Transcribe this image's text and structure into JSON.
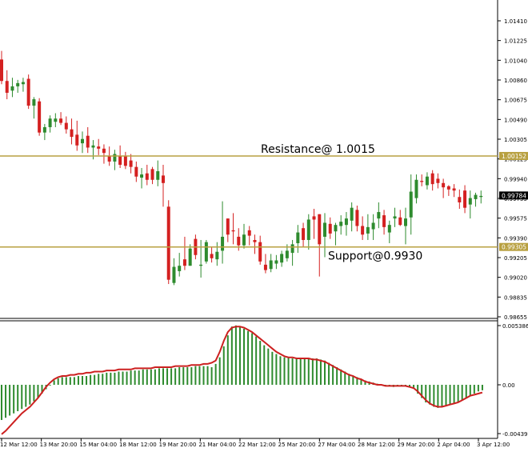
{
  "chart_data": [
    {
      "type": "candlestick",
      "title": "",
      "up_color": "#2e8b2e",
      "down_color": "#d42020",
      "ylim": [
        0.9866,
        1.015
      ],
      "y_ticks": [
        "1.01410",
        "1.01225",
        "1.01040",
        "1.00860",
        "1.00675",
        "1.00490",
        "1.00305",
        "1.00125",
        "0.99940",
        "0.99755",
        "0.99575",
        "0.99390",
        "0.99205",
        "0.99020",
        "0.98835",
        "0.98655"
      ],
      "current_price": "0.99784",
      "candles": [
        {
          "o": 1.0105,
          "h": 1.0113,
          "l": 1.0082,
          "c": 1.0085
        },
        {
          "o": 1.0085,
          "h": 1.0095,
          "l": 1.0068,
          "c": 1.0074
        },
        {
          "o": 1.0076,
          "h": 1.0088,
          "l": 1.007,
          "c": 1.008
        },
        {
          "o": 1.008,
          "h": 1.0086,
          "l": 1.0074,
          "c": 1.0083
        },
        {
          "o": 1.0082,
          "h": 1.0088,
          "l": 1.0075,
          "c": 1.0084
        },
        {
          "o": 1.0087,
          "h": 1.0091,
          "l": 1.0059,
          "c": 1.0062
        },
        {
          "o": 1.0062,
          "h": 1.007,
          "l": 1.005,
          "c": 1.0068
        },
        {
          "o": 1.0066,
          "h": 1.0069,
          "l": 1.0034,
          "c": 1.0037
        },
        {
          "o": 1.0037,
          "h": 1.0045,
          "l": 1.003,
          "c": 1.0042
        },
        {
          "o": 1.0042,
          "h": 1.0053,
          "l": 1.0037,
          "c": 1.005
        },
        {
          "o": 1.0047,
          "h": 1.0055,
          "l": 1.0042,
          "c": 1.005
        },
        {
          "o": 1.005,
          "h": 1.0056,
          "l": 1.0044,
          "c": 1.0046
        },
        {
          "o": 1.0046,
          "h": 1.0052,
          "l": 1.0036,
          "c": 1.004
        },
        {
          "o": 1.004,
          "h": 1.005,
          "l": 1.0026,
          "c": 1.0033
        },
        {
          "o": 1.0035,
          "h": 1.0048,
          "l": 1.002,
          "c": 1.0025
        },
        {
          "o": 1.0027,
          "h": 1.0038,
          "l": 1.0018,
          "c": 1.0031
        },
        {
          "o": 1.0034,
          "h": 1.0042,
          "l": 1.0018,
          "c": 1.0023
        },
        {
          "o": 1.0023,
          "h": 1.003,
          "l": 1.0012,
          "c": 1.0025
        },
        {
          "o": 1.0024,
          "h": 1.0031,
          "l": 1.0016,
          "c": 1.0022
        },
        {
          "o": 1.0022,
          "h": 1.0026,
          "l": 1.0008,
          "c": 1.0018
        },
        {
          "o": 1.0015,
          "h": 1.0024,
          "l": 1.0006,
          "c": 1.001
        },
        {
          "o": 1.001,
          "h": 1.0021,
          "l": 1.0002,
          "c": 1.0017
        },
        {
          "o": 1.0015,
          "h": 1.0025,
          "l": 1.0004,
          "c": 1.0007
        },
        {
          "o": 1.0015,
          "h": 1.0019,
          "l": 1.0003,
          "c": 1.0006
        },
        {
          "o": 1.0011,
          "h": 1.0017,
          "l": 0.9999,
          "c": 1.0005
        },
        {
          "o": 1.0005,
          "h": 1.001,
          "l": 0.9991,
          "c": 0.9996
        },
        {
          "o": 0.9995,
          "h": 1.0004,
          "l": 0.9985,
          "c": 0.9998
        },
        {
          "o": 0.9999,
          "h": 1.0007,
          "l": 0.9988,
          "c": 0.9993
        },
        {
          "o": 1.0003,
          "h": 1.0005,
          "l": 0.9989,
          "c": 0.9993
        },
        {
          "o": 0.9993,
          "h": 1.0011,
          "l": 0.9987,
          "c": 1.0001
        },
        {
          "o": 0.9997,
          "h": 1.0007,
          "l": 0.9968,
          "c": 0.999
        },
        {
          "o": 0.9968,
          "h": 0.9974,
          "l": 0.9896,
          "c": 0.99
        },
        {
          "o": 0.9897,
          "h": 0.992,
          "l": 0.9895,
          "c": 0.9912
        },
        {
          "o": 0.9908,
          "h": 0.9925,
          "l": 0.9903,
          "c": 0.9913
        },
        {
          "o": 0.9919,
          "h": 0.994,
          "l": 0.9909,
          "c": 0.9913
        },
        {
          "o": 0.9913,
          "h": 0.9933,
          "l": 0.9913,
          "c": 0.9929
        },
        {
          "o": 0.9938,
          "h": 0.9942,
          "l": 0.9919,
          "c": 0.9923
        },
        {
          "o": 0.9913,
          "h": 0.9937,
          "l": 0.9902,
          "c": 0.9914
        },
        {
          "o": 0.9917,
          "h": 0.9937,
          "l": 0.9915,
          "c": 0.9935
        },
        {
          "o": 0.9924,
          "h": 0.993,
          "l": 0.9916,
          "c": 0.992
        },
        {
          "o": 0.9919,
          "h": 0.9935,
          "l": 0.9913,
          "c": 0.9926
        },
        {
          "o": 0.9927,
          "h": 0.9973,
          "l": 0.9915,
          "c": 0.994
        },
        {
          "o": 0.9957,
          "h": 0.9957,
          "l": 0.9935,
          "c": 0.9942
        },
        {
          "o": 0.9946,
          "h": 0.9962,
          "l": 0.9933,
          "c": 0.9945
        },
        {
          "o": 0.994,
          "h": 0.9948,
          "l": 0.9927,
          "c": 0.9932
        },
        {
          "o": 0.9932,
          "h": 0.9952,
          "l": 0.9929,
          "c": 0.9942
        },
        {
          "o": 0.9946,
          "h": 0.995,
          "l": 0.9932,
          "c": 0.9941
        },
        {
          "o": 0.9937,
          "h": 0.9942,
          "l": 0.9924,
          "c": 0.9935
        },
        {
          "o": 0.9935,
          "h": 0.9941,
          "l": 0.9914,
          "c": 0.9917
        },
        {
          "o": 0.9914,
          "h": 0.9924,
          "l": 0.9906,
          "c": 0.9909
        },
        {
          "o": 0.991,
          "h": 0.9924,
          "l": 0.9907,
          "c": 0.9918
        },
        {
          "o": 0.9915,
          "h": 0.9923,
          "l": 0.991,
          "c": 0.9918
        },
        {
          "o": 0.9916,
          "h": 0.9927,
          "l": 0.9912,
          "c": 0.9924
        },
        {
          "o": 0.992,
          "h": 0.9933,
          "l": 0.9917,
          "c": 0.9927
        },
        {
          "o": 0.9925,
          "h": 0.9937,
          "l": 0.9913,
          "c": 0.9933
        },
        {
          "o": 0.9934,
          "h": 0.9951,
          "l": 0.9925,
          "c": 0.9944
        },
        {
          "o": 0.9948,
          "h": 0.9953,
          "l": 0.993,
          "c": 0.9937
        },
        {
          "o": 0.9937,
          "h": 0.9961,
          "l": 0.9928,
          "c": 0.9956
        },
        {
          "o": 0.9959,
          "h": 0.9966,
          "l": 0.9938,
          "c": 0.9956
        },
        {
          "o": 0.9961,
          "h": 0.9961,
          "l": 0.9903,
          "c": 0.9933
        },
        {
          "o": 0.994,
          "h": 0.9962,
          "l": 0.9921,
          "c": 0.9953
        },
        {
          "o": 0.9952,
          "h": 0.9958,
          "l": 0.9938,
          "c": 0.9943
        },
        {
          "o": 0.9945,
          "h": 0.9953,
          "l": 0.9932,
          "c": 0.9951
        },
        {
          "o": 0.995,
          "h": 0.996,
          "l": 0.9942,
          "c": 0.9954
        },
        {
          "o": 0.9951,
          "h": 0.9963,
          "l": 0.9941,
          "c": 0.9957
        },
        {
          "o": 0.9955,
          "h": 0.9972,
          "l": 0.9945,
          "c": 0.9967
        },
        {
          "o": 0.9965,
          "h": 0.9969,
          "l": 0.9945,
          "c": 0.995
        },
        {
          "o": 0.995,
          "h": 0.9959,
          "l": 0.9937,
          "c": 0.9942
        },
        {
          "o": 0.9943,
          "h": 0.9961,
          "l": 0.9937,
          "c": 0.9949
        },
        {
          "o": 0.9947,
          "h": 0.9961,
          "l": 0.9937,
          "c": 0.9953
        },
        {
          "o": 0.9957,
          "h": 0.9972,
          "l": 0.9948,
          "c": 0.9963
        },
        {
          "o": 0.996,
          "h": 0.9965,
          "l": 0.9942,
          "c": 0.9949
        },
        {
          "o": 0.9944,
          "h": 0.9955,
          "l": 0.9934,
          "c": 0.9951
        },
        {
          "o": 0.9957,
          "h": 0.9967,
          "l": 0.9949,
          "c": 0.9959
        },
        {
          "o": 0.9958,
          "h": 0.9965,
          "l": 0.995,
          "c": 0.9951
        },
        {
          "o": 0.995,
          "h": 0.9967,
          "l": 0.9933,
          "c": 0.9957
        },
        {
          "o": 0.9958,
          "h": 0.9998,
          "l": 0.9942,
          "c": 0.9982
        },
        {
          "o": 0.9976,
          "h": 0.9998,
          "l": 0.9971,
          "c": 0.9993
        },
        {
          "o": 0.9992,
          "h": 0.9998,
          "l": 0.9987,
          "c": 0.9991
        },
        {
          "o": 0.9988,
          "h": 1.0,
          "l": 0.9984,
          "c": 0.9996
        },
        {
          "o": 0.9999,
          "h": 1.0002,
          "l": 0.9983,
          "c": 0.9989
        },
        {
          "o": 0.9994,
          "h": 0.9999,
          "l": 0.9985,
          "c": 0.999
        },
        {
          "o": 0.999,
          "h": 0.9994,
          "l": 0.9976,
          "c": 0.9986
        },
        {
          "o": 0.9987,
          "h": 0.9988,
          "l": 0.9978,
          "c": 0.9984
        },
        {
          "o": 0.9985,
          "h": 0.9989,
          "l": 0.9977,
          "c": 0.9983
        },
        {
          "o": 0.9977,
          "h": 0.9984,
          "l": 0.9966,
          "c": 0.9972
        },
        {
          "o": 0.9983,
          "h": 0.9988,
          "l": 0.9962,
          "c": 0.9967
        },
        {
          "o": 0.997,
          "h": 0.9983,
          "l": 0.9957,
          "c": 0.9976
        },
        {
          "o": 0.9975,
          "h": 0.9981,
          "l": 0.9968,
          "c": 0.9979
        },
        {
          "o": 0.9977,
          "h": 0.9983,
          "l": 0.9971,
          "c": 0.9978
        }
      ],
      "lines": [
        {
          "label": "Resistance@ 1.0015",
          "value": 1.00152,
          "tag": "1.00152",
          "color": "#b8a040"
        },
        {
          "label": "Support@0.9930",
          "value": 0.99305,
          "tag": "0.99305",
          "color": "#b8a040"
        }
      ]
    },
    {
      "type": "bar+line",
      "bar_color": "#2e8b2e",
      "line_color": "#cc2020",
      "ylim": [
        -0.0045,
        0.0056
      ],
      "y_ticks": [
        "0.005386",
        "0.00",
        "-0.004399"
      ],
      "histogram": [
        -0.0032,
        -0.003,
        -0.0028,
        -0.0026,
        -0.0024,
        -0.0022,
        -0.002,
        -0.0018,
        -0.0015,
        -0.0012,
        -0.0008,
        -0.0004,
        0.0,
        0.0004,
        0.0006,
        0.0007,
        0.0007,
        0.0007,
        0.0007,
        0.0008,
        0.0008,
        0.0008,
        0.0009,
        0.0009,
        0.001,
        0.001,
        0.0011,
        0.0011,
        0.0011,
        0.0012,
        0.0012,
        0.0012,
        0.0013,
        0.0013,
        0.0013,
        0.0014,
        0.0014,
        0.0014,
        0.0014,
        0.0015,
        0.0015,
        0.0015,
        0.0015,
        0.0015,
        0.0016,
        0.0016,
        0.0016,
        0.0016,
        0.0017,
        0.0017,
        0.0017,
        0.0017,
        0.0016,
        0.0019,
        0.0025,
        0.0035,
        0.0045,
        0.0053,
        0.0054,
        0.0053,
        0.0051,
        0.0049,
        0.0047,
        0.0044,
        0.004,
        0.0036,
        0.0033,
        0.003,
        0.0028,
        0.0026,
        0.0025,
        0.0025,
        0.0024,
        0.0024,
        0.0024,
        0.0024,
        0.0024,
        0.0024,
        0.0024,
        0.0023,
        0.0022,
        0.002,
        0.0018,
        0.0016,
        0.0014,
        0.0012,
        0.001,
        0.0008,
        0.0007,
        0.0005,
        0.0004,
        0.0003,
        0.0002,
        0.0001,
        0.0,
        -0.0001,
        -0.0001,
        -0.0002,
        -0.0001,
        -0.0001,
        -0.0001,
        -0.0002,
        -0.0003,
        -0.0008,
        -0.0012,
        -0.0016,
        -0.0018,
        -0.002,
        -0.0021,
        -0.002,
        -0.0019,
        -0.0018,
        -0.0017,
        -0.0016,
        -0.0014,
        -0.0012,
        -0.001,
        -0.0008,
        -0.0006,
        -0.0005
      ],
      "signal": [
        -0.0045,
        -0.0042,
        -0.0038,
        -0.0034,
        -0.003,
        -0.0026,
        -0.0023,
        -0.002,
        -0.0016,
        -0.0012,
        -0.0007,
        -0.0002,
        0.0002,
        0.0005,
        0.0007,
        0.0008,
        0.0008,
        0.0009,
        0.0009,
        0.001,
        0.001,
        0.0011,
        0.0011,
        0.0012,
        0.0012,
        0.0012,
        0.0013,
        0.0013,
        0.0013,
        0.0014,
        0.0014,
        0.0014,
        0.0014,
        0.0015,
        0.0015,
        0.0015,
        0.0015,
        0.0015,
        0.0016,
        0.0016,
        0.0016,
        0.0016,
        0.0016,
        0.0017,
        0.0017,
        0.0017,
        0.0017,
        0.0018,
        0.0018,
        0.0018,
        0.0019,
        0.0019,
        0.002,
        0.0022,
        0.003,
        0.004,
        0.0048,
        0.0052,
        0.0053,
        0.0053,
        0.0052,
        0.005,
        0.0048,
        0.0045,
        0.0042,
        0.0039,
        0.0036,
        0.0033,
        0.003,
        0.0028,
        0.0026,
        0.0025,
        0.0025,
        0.0024,
        0.0024,
        0.0024,
        0.0024,
        0.0023,
        0.0023,
        0.0022,
        0.0021,
        0.0019,
        0.0017,
        0.0015,
        0.0013,
        0.0011,
        0.0009,
        0.0008,
        0.0006,
        0.0005,
        0.0003,
        0.0002,
        0.0001,
        0.0,
        0.0,
        -0.0001,
        -0.0001,
        -0.0001,
        -0.0001,
        -0.0001,
        -0.0001,
        -0.0002,
        -0.0003,
        -0.0006,
        -0.001,
        -0.0014,
        -0.0017,
        -0.0019,
        -0.002,
        -0.002,
        -0.0019,
        -0.0018,
        -0.0017,
        -0.0016,
        -0.0014,
        -0.0012,
        -0.001,
        -0.0009,
        -0.0008,
        -0.0007
      ]
    }
  ],
  "x_ticks": [
    "12 Mar 12:00",
    "13 Mar 20:00",
    "15 Mar 04:00",
    "18 Mar 12:00",
    "19 Mar 20:00",
    "21 Mar 04:00",
    "22 Mar 12:00",
    "25 Mar 20:00",
    "27 Mar 04:00",
    "28 Mar 12:00",
    "29 Mar 20:00",
    "2 Apr 04:00",
    "3 Apr 12:00"
  ]
}
